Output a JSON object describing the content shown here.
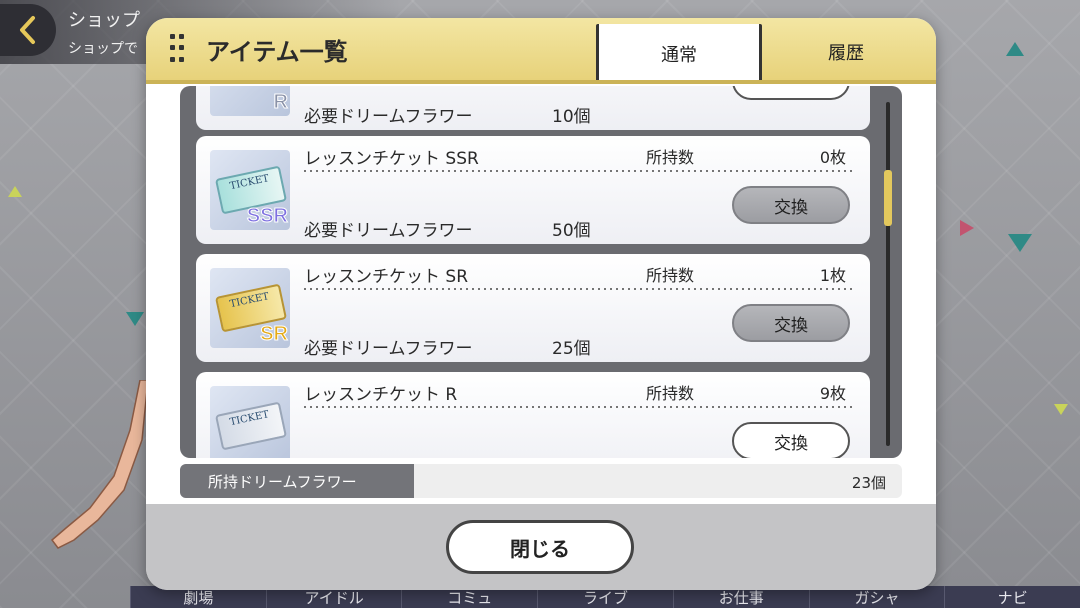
{
  "background": {
    "shop_title": "ショップ",
    "shop_subtitle": "ショップで",
    "nav": [
      "劇場",
      "アイドル",
      "コミュ",
      "ライブ",
      "お仕事",
      "ガシャ",
      "ナビ"
    ]
  },
  "modal": {
    "title": "アイテム一覧",
    "tabs": {
      "normal": "通常",
      "history": "履歴"
    },
    "partial_top_card": {
      "rank_text": "R",
      "req_label": "必要ドリームフラワー",
      "req_value": "10個"
    },
    "items": [
      {
        "name": "レッスンチケット SSR",
        "owned_label": "所持数",
        "owned_value": "0枚",
        "req_label": "必要ドリームフラワー",
        "req_value": "50個",
        "button": "交換",
        "ticket_text": "TICKET",
        "rank_text": "SSR",
        "icon": "lesson-ticket-ssr-icon"
      },
      {
        "name": "レッスンチケット SR",
        "owned_label": "所持数",
        "owned_value": "1枚",
        "req_label": "必要ドリームフラワー",
        "req_value": "25個",
        "button": "交換",
        "ticket_text": "TICKET",
        "rank_text": "SR",
        "icon": "lesson-ticket-sr-icon"
      },
      {
        "name": "レッスンチケット R",
        "owned_label": "所持数",
        "owned_value": "9枚",
        "button": "交換",
        "ticket_text": "TICKET",
        "icon": "lesson-ticket-r-icon"
      }
    ],
    "currency_label": "所持ドリームフラワー",
    "currency_value": "23個",
    "close_button": "閉じる"
  },
  "colors": {
    "header_gold": "#e7d27a",
    "scroll_thumb": "#e3c85d",
    "footer_gray": "#c4c4c6"
  }
}
